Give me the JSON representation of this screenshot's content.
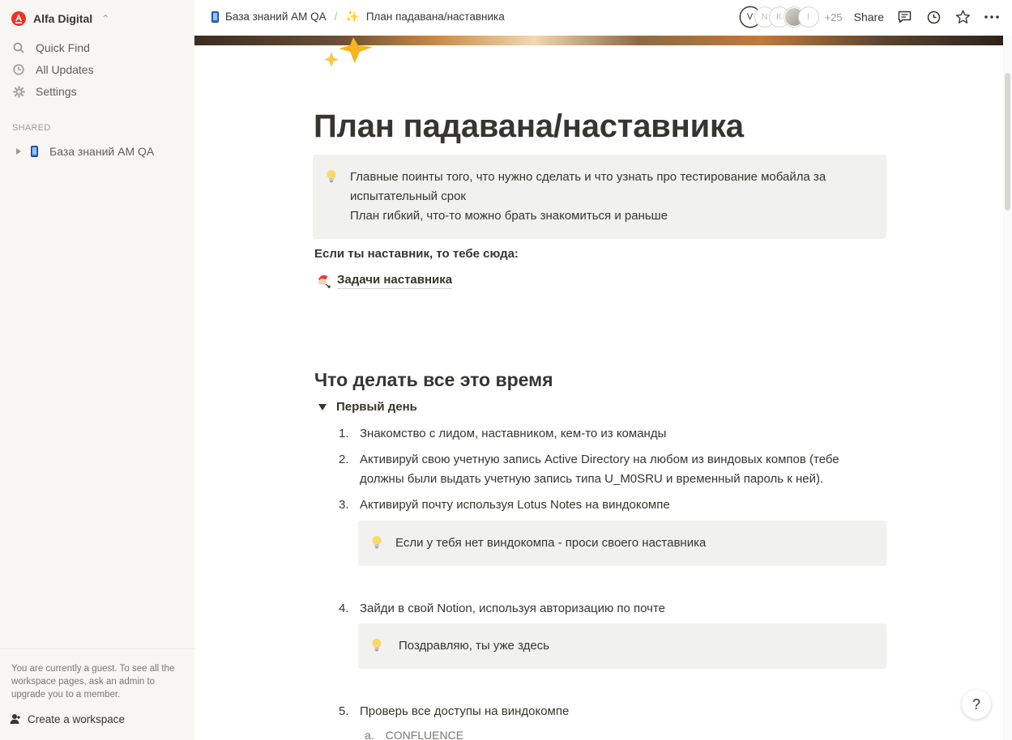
{
  "sidebar": {
    "workspace_name": "Alfa Digital",
    "nav": [
      {
        "label": "Quick Find",
        "icon": "search-icon"
      },
      {
        "label": "All Updates",
        "icon": "clock-icon"
      },
      {
        "label": "Settings",
        "icon": "gear-icon"
      }
    ],
    "section_label": "SHARED",
    "shared_page": {
      "label": "База знаний AM QA",
      "icon": "mobile-phone-icon"
    },
    "guest_notice": "You are currently a guest. To see all the workspace pages, ask an admin to upgrade you to a member.",
    "create_workspace": "Create a workspace"
  },
  "topbar": {
    "breadcrumb": [
      {
        "label": "База знаний AM QA",
        "icon": "mobile-phone-icon"
      },
      {
        "label": "План падавана/наставника",
        "icon": "sparkles-icon"
      }
    ],
    "avatars": [
      "V",
      "N",
      "K",
      "",
      "I"
    ],
    "avatar_count": "+25",
    "share_label": "Share"
  },
  "page": {
    "title": "План падавана/наставника",
    "intro_callout": {
      "line1": "Главные поинты того, что нужно сделать и что узнать про тестирование мобайла за",
      "line2": "испытательный срок",
      "line3": "План гибкий, что-то можно брать знакомиться и раньше"
    },
    "mentor_prompt": "Если ты наставник, то тебе сюда:",
    "mentor_link": "Задачи наставника",
    "section_heading": "Что делать все это время",
    "toggle_label": "Первый день",
    "items": [
      {
        "num": "1.",
        "text": "Знакомство с лидом, наставником, кем-то из команды"
      },
      {
        "num": "2.",
        "line1": "Активируй свою учетную запись Active Directory на любом из виндовых компов (тебе",
        "line2": "должны были выдать учетную запись типа U_M0SRU и временный пароль к ней)."
      },
      {
        "num": "3.",
        "text": "Активируй почту используя Lotus Notes на виндокомпе"
      },
      {
        "num": "4.",
        "text": "Зайди в свой Notion, используя авторизацию по почте"
      },
      {
        "num": "5.",
        "text": "Проверь все доступы на виндокомпе"
      }
    ],
    "callout_no_pc": "Если у тебя нет виндокомпа - проси своего наставника",
    "callout_here": "Поздравляю, ты уже здесь",
    "sub_item": {
      "num": "a.",
      "text": "CONFLUENCE"
    }
  },
  "help_label": "?"
}
